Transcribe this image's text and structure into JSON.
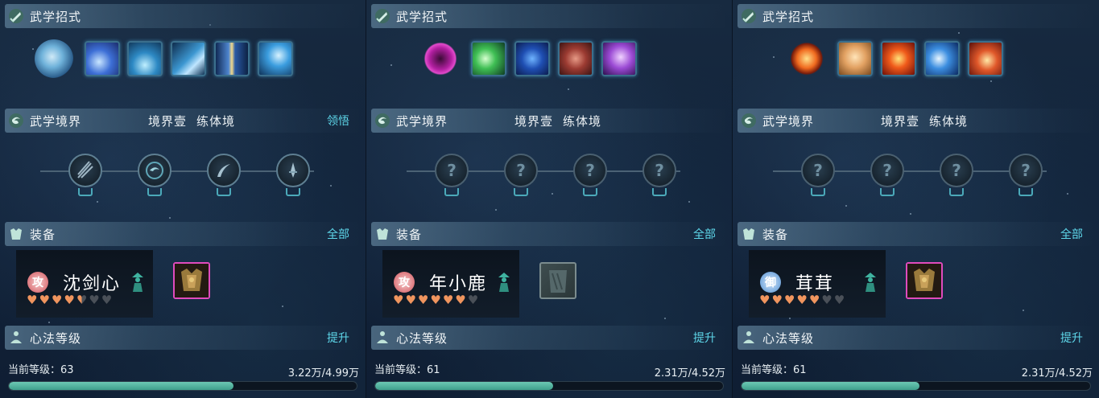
{
  "panels": [
    {
      "skills_header": "武学招式",
      "realm_header": "武学境界",
      "realm_stage": "境界壹",
      "realm_name": "练体境",
      "realm_action": "领悟",
      "realm_nodes": [
        "sword-cluster",
        "swirl-disc",
        "blade-slash",
        "dagger"
      ],
      "skills": [
        "water-orb",
        "blue-slash",
        "whirlwind",
        "ice-sweep",
        "light-pillar",
        "dash-strike"
      ],
      "equip_header": "装备",
      "equip_action": "全部",
      "hero": {
        "badge": "攻",
        "badge_color": "#d2525a",
        "name": "沈剑心",
        "hearts_total": 7,
        "hearts_filled": 4.5
      },
      "equip_item": "armor",
      "level_header": "心法等级",
      "level_action": "提升",
      "level_label": "当前等级：63",
      "level_value": "3.22万/4.99万",
      "level_progress": 0.645
    },
    {
      "skills_header": "武学招式",
      "realm_header": "武学境界",
      "realm_stage": "境界壹",
      "realm_name": "练体境",
      "realm_action": "",
      "realm_nodes": [
        "locked",
        "locked",
        "locked",
        "locked"
      ],
      "skills": [
        "pink-rune",
        "green-burst",
        "blue-waves",
        "red-thorns",
        "purple-spirit"
      ],
      "equip_header": "装备",
      "equip_action": "全部",
      "hero": {
        "badge": "攻",
        "badge_color": "#d2525a",
        "name": "年小鹿",
        "hearts_total": 7,
        "hearts_filled": 6
      },
      "equip_item": "empty-scroll",
      "level_header": "心法等级",
      "level_action": "提升",
      "level_label": "当前等级：61",
      "level_value": "2.31万/4.52万",
      "level_progress": 0.511
    },
    {
      "skills_header": "武学招式",
      "realm_header": "武学境界",
      "realm_stage": "境界壹",
      "realm_name": "练体境",
      "realm_action": "",
      "realm_nodes": [
        "locked",
        "locked",
        "locked",
        "locked"
      ],
      "skills": [
        "fire-figure",
        "buddha-face",
        "fire-blast",
        "crescent-moon",
        "flame-vortex"
      ],
      "equip_header": "装备",
      "equip_action": "全部",
      "hero": {
        "badge": "御",
        "badge_color": "#4f8fd2",
        "name": "茸茸",
        "hearts_total": 7,
        "hearts_filled": 5
      },
      "equip_item": "armor",
      "level_header": "心法等级",
      "level_action": "提升",
      "level_label": "当前等级：61",
      "level_value": "2.31万/4.52万",
      "level_progress": 0.511
    }
  ],
  "colors": {
    "accent": "#5ed7ea",
    "progress": "#4fb39e",
    "heart_on": "#f0955e",
    "heart_off": "#4a5058",
    "rare_border": "#e04bbd"
  }
}
